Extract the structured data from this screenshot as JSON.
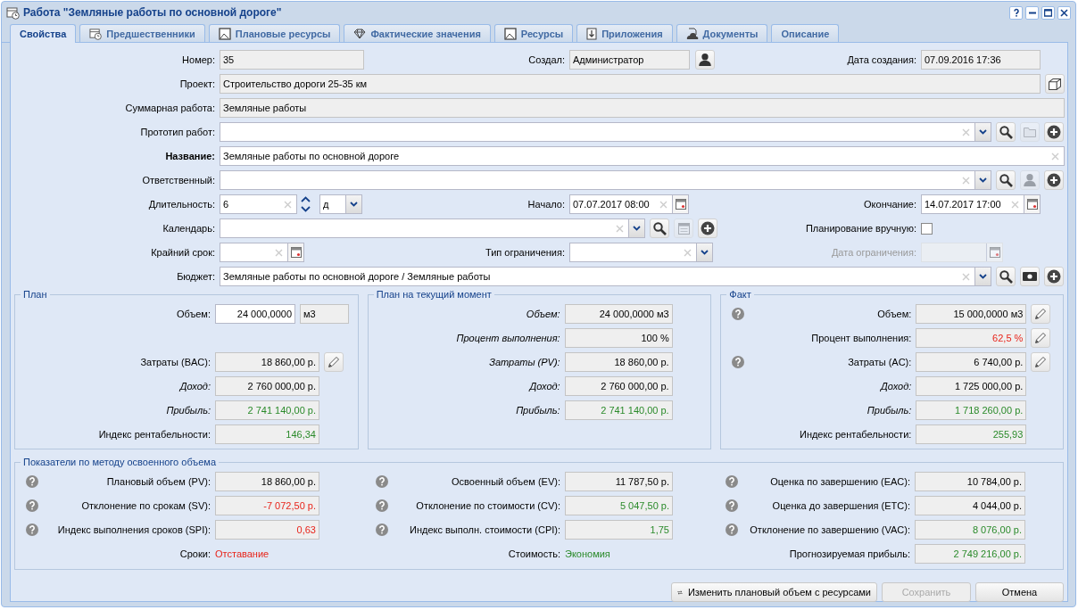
{
  "window": {
    "title": "Работа \"Земляные работы по основной дороге\""
  },
  "tabs": [
    {
      "label": "Свойства",
      "selected": true
    },
    {
      "label": "Предшественники",
      "selected": false
    },
    {
      "label": "Плановые ресурсы",
      "selected": false
    },
    {
      "label": "Фактические значения",
      "selected": false
    },
    {
      "label": "Ресурсы",
      "selected": false
    },
    {
      "label": "Приложения",
      "selected": false
    },
    {
      "label": "Документы",
      "selected": false
    },
    {
      "label": "Описание",
      "selected": false
    }
  ],
  "fields": {
    "number": {
      "label": "Номер:",
      "value": "35"
    },
    "creator": {
      "label": "Создал:",
      "value": "Администратор",
      "buttons": [
        {
          "kind": "user",
          "disabled": false
        }
      ]
    },
    "created": {
      "label": "Дата создания:",
      "value": "07.09.2016 17:36"
    },
    "project": {
      "label": "Проект:",
      "value": "Строительство дороги 25-35 км",
      "buttons": [
        {
          "kind": "box",
          "disabled": false
        }
      ]
    },
    "summary": {
      "label": "Суммарная работа:",
      "value": "Земляные работы"
    },
    "prototype": {
      "label": "Прототип работ:",
      "buttons": [
        {
          "kind": "search",
          "disabled": false
        },
        {
          "kind": "folder",
          "disabled": true
        },
        {
          "kind": "add",
          "disabled": false
        }
      ]
    },
    "name": {
      "label": "Название:",
      "value": "Земляные работы по основной дороге"
    },
    "responsible": {
      "label": "Ответственный:",
      "buttons": [
        {
          "kind": "search",
          "disabled": false
        },
        {
          "kind": "user",
          "disabled": true
        },
        {
          "kind": "add",
          "disabled": false
        }
      ]
    },
    "duration": {
      "label": "Длительность:",
      "value": "6",
      "unit": "д"
    },
    "start": {
      "label": "Начало:",
      "value": "07.07.2017 08:00"
    },
    "finish": {
      "label": "Окончание:",
      "value": "14.07.2017 17:00"
    },
    "calendar": {
      "label": "Календарь:",
      "buttons": [
        {
          "kind": "search",
          "disabled": false
        },
        {
          "kind": "calendar",
          "disabled": true
        },
        {
          "kind": "add",
          "disabled": false
        }
      ]
    },
    "manual": {
      "label": "Планирование вручную:",
      "checked": false
    },
    "deadline": {
      "label": "Крайний срок:"
    },
    "constraint_type": {
      "label": "Тип ограничения:"
    },
    "constraint_date": {
      "label": "Дата ограничения:",
      "disabled": true
    },
    "budget": {
      "label": "Бюджет:",
      "value": "Земляные работы по основной дороге / Земляные работы",
      "buttons": [
        {
          "kind": "search",
          "disabled": false
        },
        {
          "kind": "money",
          "disabled": false
        },
        {
          "kind": "add",
          "disabled": false
        }
      ]
    }
  },
  "panels": [
    {
      "title": "План",
      "rows": [
        {
          "kind": "input",
          "label": "Объем:",
          "value": "24 000,0000",
          "unit": "м3",
          "italic": false,
          "help": false,
          "editable": false
        },
        {
          "kind": "output",
          "label": "Затраты (BAC):",
          "value": "18 860,00 р.",
          "italic": false,
          "positive": false,
          "negative": false,
          "help": false,
          "editable": true
        },
        {
          "kind": "output",
          "label": "Доход:",
          "value": "2 760 000,00 р.",
          "italic": true,
          "positive": false,
          "negative": false,
          "help": false,
          "editable": false
        },
        {
          "kind": "output",
          "label": "Прибыль:",
          "value": "2 741 140,00 р.",
          "italic": true,
          "positive": true,
          "negative": false,
          "help": false,
          "editable": false
        },
        {
          "kind": "output",
          "label": "Индекс рентабельности:",
          "value": "146,34",
          "italic": false,
          "positive": true,
          "negative": false,
          "help": false,
          "editable": false
        }
      ]
    },
    {
      "title": "План на текущий момент",
      "rows": [
        {
          "kind": "output",
          "label": "Объем:",
          "value": "24 000,0000 м3",
          "italic": true,
          "positive": false,
          "negative": false,
          "help": false,
          "editable": false
        },
        {
          "kind": "output",
          "label": "Процент выполнения:",
          "value": "100 %",
          "italic": true,
          "positive": false,
          "negative": false,
          "help": false,
          "editable": false
        },
        {
          "kind": "output",
          "label": "Затраты (PV):",
          "value": "18 860,00 р.",
          "italic": true,
          "positive": false,
          "negative": false,
          "help": false,
          "editable": false
        },
        {
          "kind": "output",
          "label": "Доход:",
          "value": "2 760 000,00 р.",
          "italic": true,
          "positive": false,
          "negative": false,
          "help": false,
          "editable": false
        },
        {
          "kind": "output",
          "label": "Прибыль:",
          "value": "2 741 140,00 р.",
          "italic": true,
          "positive": true,
          "negative": false,
          "help": false,
          "editable": false
        }
      ]
    },
    {
      "title": "Факт",
      "rows": [
        {
          "kind": "output",
          "label": "Объем:",
          "value": "15 000,0000 м3",
          "italic": false,
          "positive": false,
          "negative": false,
          "help": true,
          "editable": true
        },
        {
          "kind": "output",
          "label": "Процент выполнения:",
          "value": "62,5 %",
          "italic": false,
          "positive": false,
          "negative": true,
          "help": false,
          "editable": true
        },
        {
          "kind": "output",
          "label": "Затраты (AC):",
          "value": "6 740,00 р.",
          "italic": false,
          "positive": false,
          "negative": false,
          "help": true,
          "editable": true
        },
        {
          "kind": "output",
          "label": "Доход:",
          "value": "1 725 000,00 р.",
          "italic": true,
          "positive": false,
          "negative": false,
          "help": false,
          "editable": false
        },
        {
          "kind": "output",
          "label": "Прибыль:",
          "value": "1 718 260,00 р.",
          "italic": true,
          "positive": true,
          "negative": false,
          "help": false,
          "editable": false
        },
        {
          "kind": "output",
          "label": "Индекс рентабельности:",
          "value": "255,93",
          "italic": false,
          "positive": true,
          "negative": false,
          "help": false,
          "editable": false
        }
      ]
    }
  ],
  "evm": {
    "title": "Показатели по методу освоенного объема",
    "columns": [
      [
        {
          "kind": "field",
          "label": "Плановый объем (PV):",
          "value": "18 860,00 р.",
          "positive": false,
          "negative": false,
          "help": true
        },
        {
          "kind": "field",
          "label": "Отклонение по срокам (SV):",
          "value": "-7 072,50 р.",
          "positive": false,
          "negative": true,
          "help": true
        },
        {
          "kind": "field",
          "label": "Индекс выполнения сроков (SPI):",
          "value": "0,63",
          "positive": false,
          "negative": true,
          "help": true
        },
        {
          "kind": "status",
          "label": "Сроки:",
          "value": "Отставание",
          "positive": false,
          "negative": true,
          "help": false
        }
      ],
      [
        {
          "kind": "field",
          "label": "Освоенный объем (EV):",
          "value": "11 787,50 р.",
          "positive": false,
          "negative": false,
          "help": true
        },
        {
          "kind": "field",
          "label": "Отклонение по стоимости (CV):",
          "value": "5 047,50 р.",
          "positive": true,
          "negative": false,
          "help": true
        },
        {
          "kind": "field",
          "label": "Индекс выполн. стоимости (CPI):",
          "value": "1,75",
          "positive": true,
          "negative": false,
          "help": true
        },
        {
          "kind": "status",
          "label": "Стоимость:",
          "value": "Экономия",
          "positive": true,
          "negative": false,
          "help": false
        }
      ],
      [
        {
          "kind": "field",
          "label": "Оценка по завершению (EAC):",
          "value": "10 784,00 р.",
          "positive": false,
          "negative": false,
          "help": true
        },
        {
          "kind": "field",
          "label": "Оценка до завершения (ETC):",
          "value": "4 044,00 р.",
          "positive": false,
          "negative": false,
          "help": true
        },
        {
          "kind": "field",
          "label": "Отклонение по завершению (VAC):",
          "value": "8 076,00 р.",
          "positive": true,
          "negative": false,
          "help": true
        },
        {
          "kind": "field",
          "label": "Прогнозируемая прибыль:",
          "value": "2 749 216,00 р.",
          "positive": true,
          "negative": false,
          "help": false
        }
      ]
    ]
  },
  "buttons": [
    {
      "label": "Изменить плановый объем с ресурсами",
      "disabled": false
    },
    {
      "label": "Сохранить",
      "disabled": true
    },
    {
      "label": "Отмена",
      "disabled": false
    }
  ]
}
